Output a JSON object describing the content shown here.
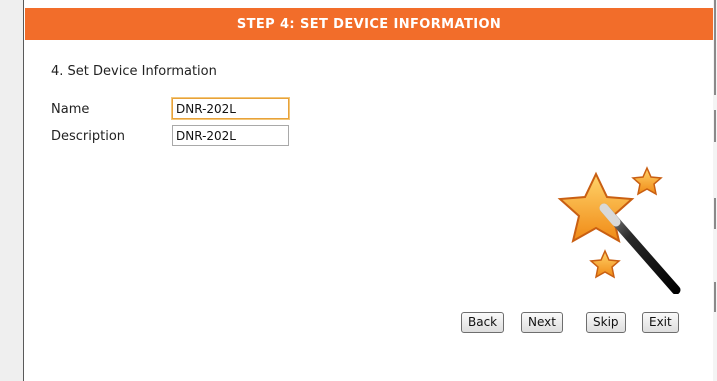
{
  "header": {
    "title": "STEP 4: SET DEVICE INFORMATION"
  },
  "section": {
    "title": "4. Set Device Information"
  },
  "form": {
    "name_label": "Name",
    "name_value": "DNR-202L",
    "description_label": "Description",
    "description_value": "DNR-202L"
  },
  "buttons": {
    "back": "Back",
    "next": "Next",
    "skip": "Skip",
    "exit": "Exit"
  },
  "icons": {
    "wizard": "magic-wand-stars-icon"
  },
  "colors": {
    "header_bg": "#f26d2a",
    "focus_border": "#e8a23a"
  }
}
